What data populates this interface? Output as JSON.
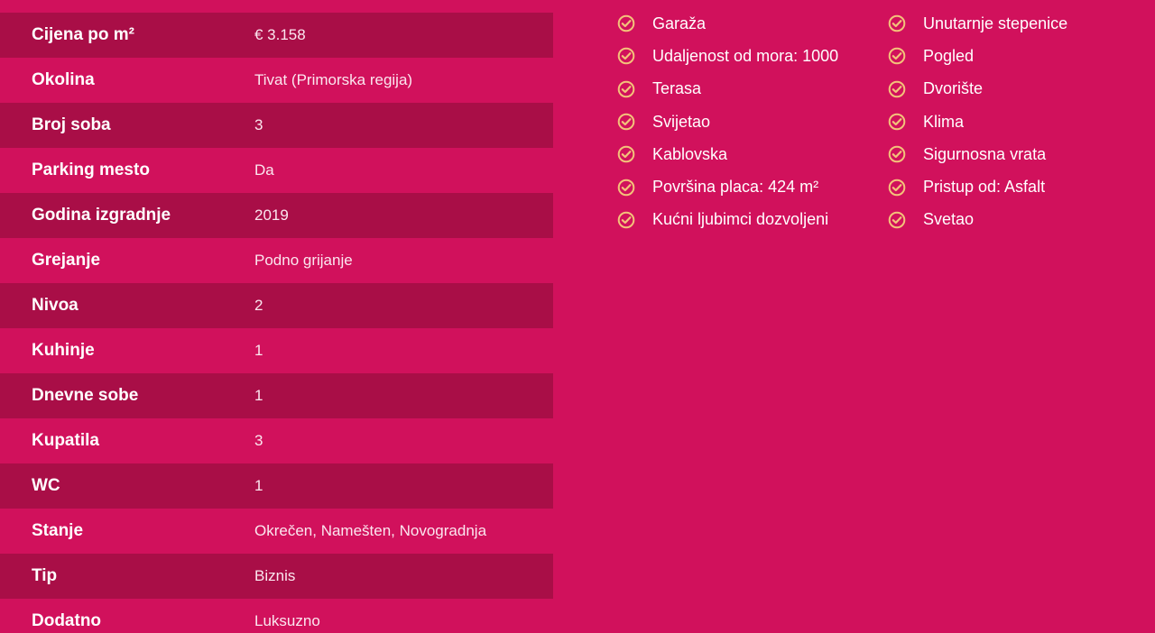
{
  "details": [
    {
      "label": "Cijena po m²",
      "value": "€ 3.158"
    },
    {
      "label": "Okolina",
      "value": "Tivat (Primorska regija)"
    },
    {
      "label": "Broj soba",
      "value": "3"
    },
    {
      "label": "Parking mesto",
      "value": "Da"
    },
    {
      "label": "Godina izgradnje",
      "value": "2019"
    },
    {
      "label": "Grejanje",
      "value": "Podno grijanje"
    },
    {
      "label": "Nivoa",
      "value": "2"
    },
    {
      "label": "Kuhinje",
      "value": "1"
    },
    {
      "label": "Dnevne sobe",
      "value": "1"
    },
    {
      "label": "Kupatila",
      "value": "3"
    },
    {
      "label": "WC",
      "value": "1"
    },
    {
      "label": "Stanje",
      "value": "Okrečen, Namešten, Novogradnja"
    },
    {
      "label": "Tip",
      "value": "Biznis"
    },
    {
      "label": "Dodatno",
      "value": "Luksuzno"
    }
  ],
  "features_left": [
    "Garaža",
    "Udaljenost od mora: 1000",
    "Terasa",
    "Svijetao",
    "Kablovska",
    "Površina placa: 424 m²",
    "Kućni ljubimci dozvoljeni"
  ],
  "features_right": [
    "Unutarnje stepenice",
    "Pogled",
    "Dvorište",
    "Klima",
    "Sigurnosna vrata",
    "Pristup od: Asfalt",
    "Svetao"
  ],
  "colors": {
    "background": "#d1115c",
    "row_dark": "#a90e47",
    "check_icon": "#f3c27a"
  },
  "icons": {
    "feature": "check-circle-icon"
  }
}
